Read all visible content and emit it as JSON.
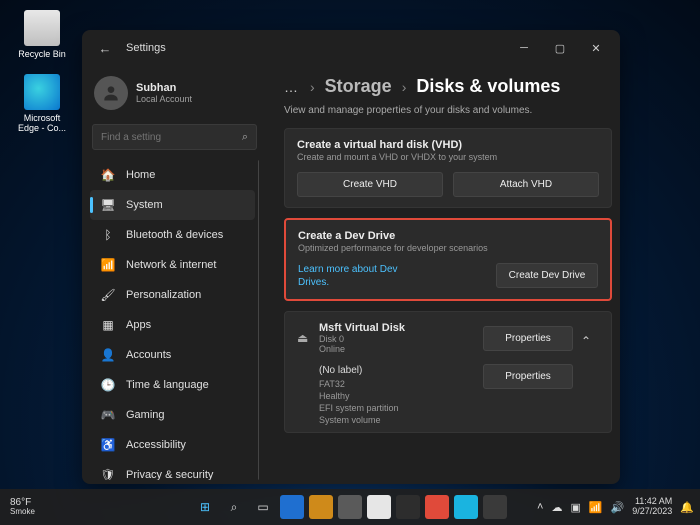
{
  "desktop": {
    "recycle": "Recycle Bin",
    "edge": "Microsoft Edge - Co..."
  },
  "window": {
    "title": "Settings",
    "user": {
      "name": "Subhan",
      "acct": "Local Account"
    },
    "search_placeholder": "Find a setting",
    "nav": [
      {
        "icon": "🏠",
        "label": "Home"
      },
      {
        "icon": "🖥",
        "label": "System"
      },
      {
        "icon": "ᛒ",
        "label": "Bluetooth & devices"
      },
      {
        "icon": "📶",
        "label": "Network & internet"
      },
      {
        "icon": "🖌",
        "label": "Personalization"
      },
      {
        "icon": "▦",
        "label": "Apps"
      },
      {
        "icon": "👤",
        "label": "Accounts"
      },
      {
        "icon": "🕒",
        "label": "Time & language"
      },
      {
        "icon": "🎮",
        "label": "Gaming"
      },
      {
        "icon": "♿",
        "label": "Accessibility"
      },
      {
        "icon": "🛡",
        "label": "Privacy & security"
      }
    ],
    "crumb1": "Storage",
    "crumb2": "Disks & volumes",
    "subtitle": "View and manage properties of your disks and volumes.",
    "vhd": {
      "title": "Create a virtual hard disk (VHD)",
      "sub": "Create and mount a VHD or VHDX to your system",
      "btn1": "Create VHD",
      "btn2": "Attach VHD"
    },
    "dev": {
      "title": "Create a Dev Drive",
      "sub": "Optimized performance for developer scenarios",
      "link": "Learn more about Dev Drives.",
      "btn": "Create Dev Drive"
    },
    "disk": {
      "name": "Msft Virtual Disk",
      "sub1": "Disk 0",
      "sub2": "Online",
      "btn": "Properties",
      "vol_name": "(No label)",
      "vol_l1": "FAT32",
      "vol_l2": "Healthy",
      "vol_l3": "EFI system partition",
      "vol_l4": "System volume",
      "vol_btn": "Properties"
    }
  },
  "taskbar": {
    "temp": "86°F",
    "cond": "Smoke",
    "time": "11:42 AM",
    "date": "9/27/2023"
  }
}
